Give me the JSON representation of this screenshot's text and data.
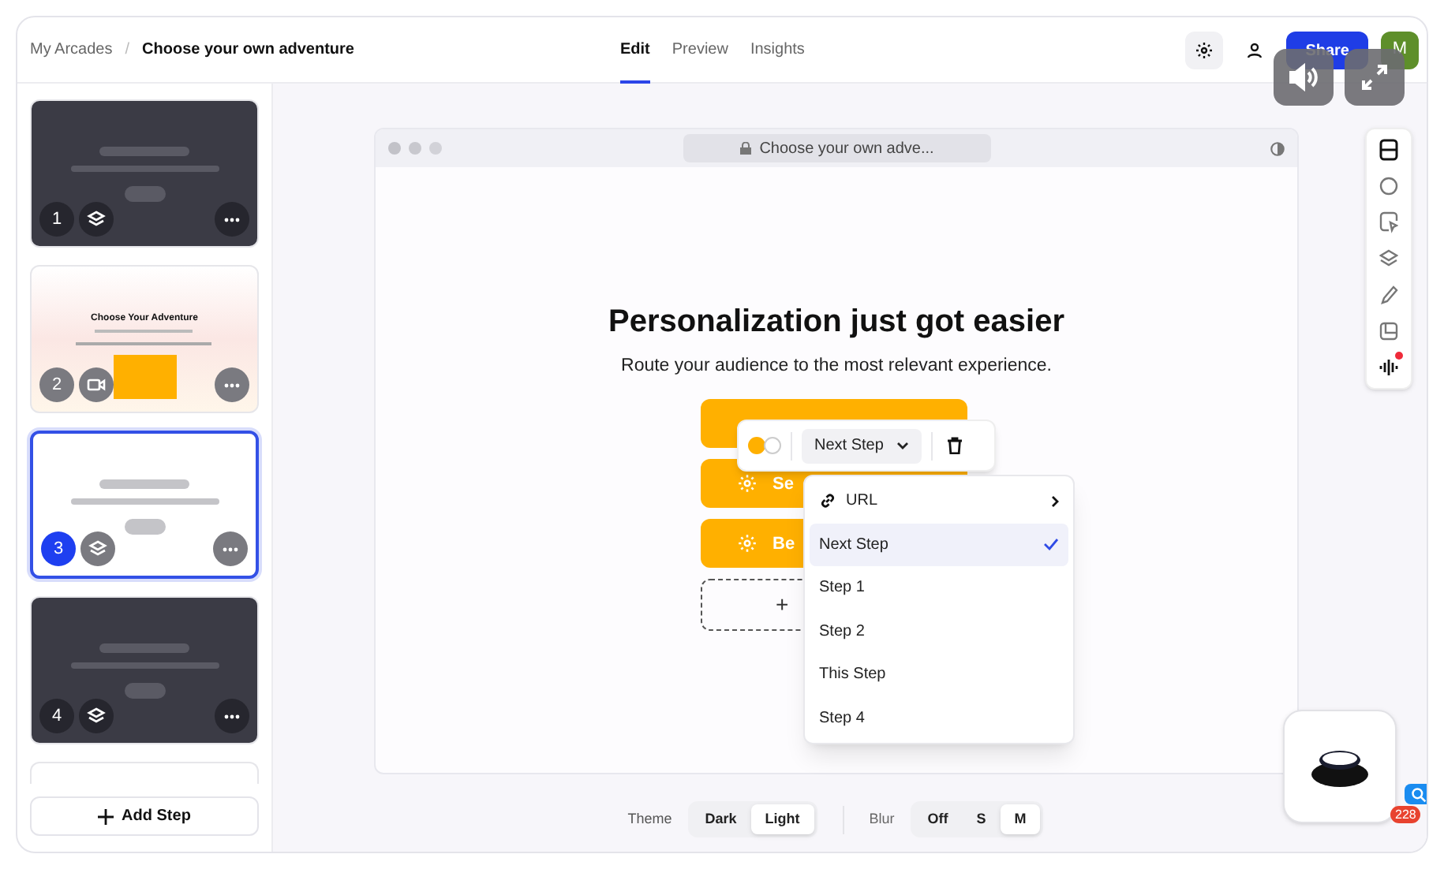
{
  "breadcrumb": {
    "parent": "My Arcades",
    "separator": "/",
    "current": "Choose your own adventure"
  },
  "tabs": [
    {
      "label": "Edit",
      "selected": true
    },
    {
      "label": "Preview",
      "selected": false
    },
    {
      "label": "Insights",
      "selected": false
    }
  ],
  "share": "Share",
  "avatar": "M",
  "steps": [
    {
      "number": "1",
      "kind": "layers",
      "dark": true,
      "selected": false
    },
    {
      "number": "2",
      "kind": "video",
      "dark": false,
      "title": "Choose Your Adventure",
      "selected": false
    },
    {
      "number": "3",
      "kind": "layers",
      "dark": false,
      "selected": true
    },
    {
      "number": "4",
      "kind": "layers",
      "dark": true,
      "selected": false
    }
  ],
  "add_step": "Add Step",
  "preview": {
    "address": "Choose your own adve...",
    "heading": "Personalization just got easier",
    "subheading": "Route your audience to the most relevant experience.",
    "choices": [
      {
        "kind": "plain"
      },
      {
        "kind": "gear",
        "label": "Se"
      },
      {
        "kind": "gear",
        "label": "Be"
      }
    ],
    "add_choice": "+"
  },
  "choice_toolbar": {
    "colors": [
      {
        "color": "#ffb000",
        "selected": true
      },
      {
        "color": "#ffffff",
        "selected": false
      }
    ],
    "target": "Next Step"
  },
  "target_menu": [
    {
      "label": "URL",
      "kind": "submenu",
      "selected": false
    },
    {
      "label": "Next Step",
      "kind": "step",
      "selected": true
    },
    {
      "label": "Step 1",
      "kind": "step",
      "selected": false
    },
    {
      "label": "Step 2",
      "kind": "step",
      "selected": false
    },
    {
      "label": "This Step",
      "kind": "step",
      "selected": false
    },
    {
      "label": "Step 4",
      "kind": "step",
      "selected": false
    }
  ],
  "side_toolbar": {
    "voice_alert": true
  },
  "theme": {
    "label": "Theme",
    "options": [
      {
        "label": "Dark",
        "selected": false
      },
      {
        "label": "Light",
        "selected": true
      }
    ]
  },
  "blur": {
    "label": "Blur",
    "options": [
      {
        "label": "Off",
        "selected": false
      },
      {
        "label": "S",
        "selected": false
      },
      {
        "label": "M",
        "selected": true
      }
    ]
  },
  "badge": "228"
}
